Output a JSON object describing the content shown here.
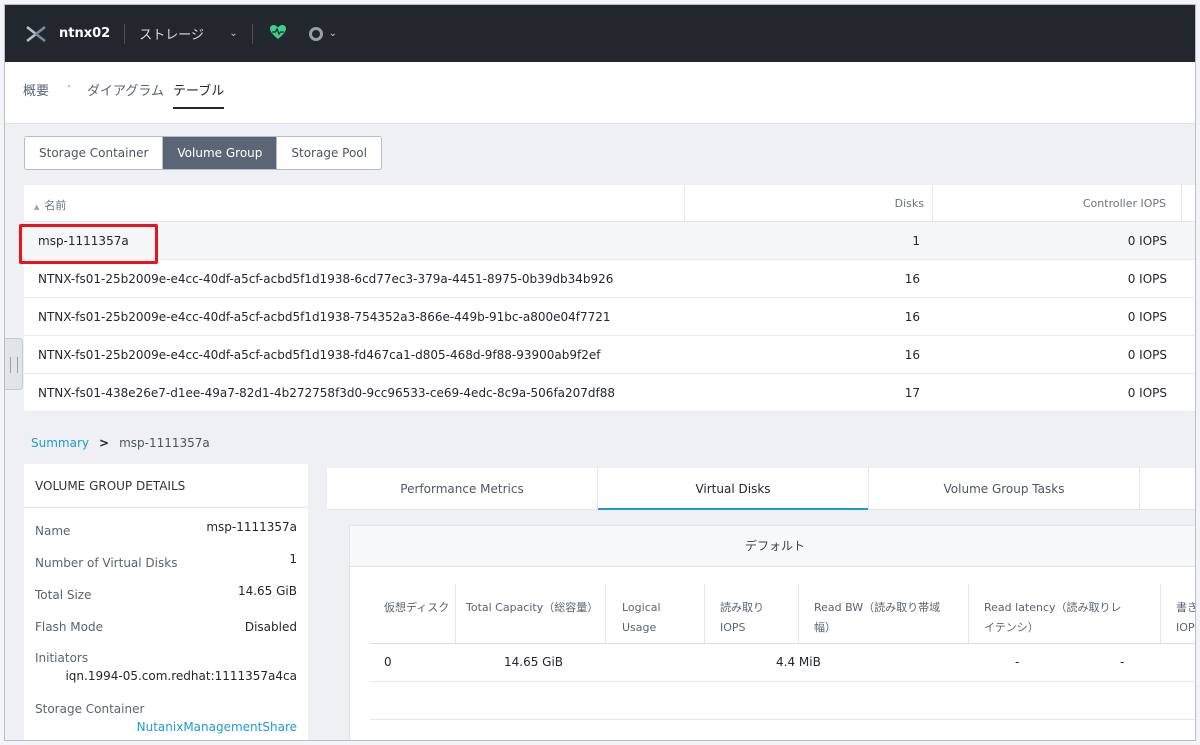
{
  "topbar": {
    "cluster_name": "ntnx02",
    "section": "ストレージ",
    "colors": {
      "bg": "#22272e",
      "health": "#3ecf8e"
    }
  },
  "subnav": {
    "items": [
      "概要",
      "ダイアグラム",
      "テーブル"
    ],
    "separator": "·",
    "active": "テーブル"
  },
  "entity_tabs": [
    "Storage Container",
    "Volume Group",
    "Storage Pool"
  ],
  "entity_tabs_active": "Volume Group",
  "table": {
    "headers": {
      "name": "名前",
      "disks": "Disks",
      "iops": "Controller IOPS"
    },
    "sort_icon": "▲",
    "rows": [
      {
        "name": "msp-1111357a",
        "disks": "1",
        "iops": "0 IOPS"
      },
      {
        "name": "NTNX-fs01-25b2009e-e4cc-40df-a5cf-acbd5f1d1938-6cd77ec3-379a-4451-8975-0b39db34b926",
        "disks": "16",
        "iops": "0 IOPS"
      },
      {
        "name": "NTNX-fs01-25b2009e-e4cc-40df-a5cf-acbd5f1d1938-754352a3-866e-449b-91bc-a800e04f7721",
        "disks": "16",
        "iops": "0 IOPS"
      },
      {
        "name": "NTNX-fs01-25b2009e-e4cc-40df-a5cf-acbd5f1d1938-fd467ca1-d805-468d-9f88-93900ab9f2ef",
        "disks": "16",
        "iops": "0 IOPS"
      },
      {
        "name": "NTNX-fs01-438e26e7-d1ee-49a7-82d1-4b272758f3d0-9cc96533-ce69-4edc-8c9a-506fa207df88",
        "disks": "17",
        "iops": "0 IOPS"
      }
    ]
  },
  "breadcrumb": {
    "root": "Summary",
    "arrow": ">",
    "current": "msp-1111357a"
  },
  "details": {
    "header": "VOLUME GROUP DETAILS",
    "name_label": "Name",
    "name_value": "msp-1111357a",
    "vdisks_label": "Number of Virtual Disks",
    "vdisks_value": "1",
    "size_label": "Total Size",
    "size_value": "14.65 GiB",
    "flash_label": "Flash Mode",
    "flash_value": "Disabled",
    "initiators_label": "Initiators",
    "initiators_value": "iqn.1994-05.com.redhat:1111357a4ca",
    "container_label": "Storage Container",
    "container_value": "NutanixManagementShare"
  },
  "right_tabs": [
    "Performance Metrics",
    "Virtual Disks",
    "Volume Group Tasks"
  ],
  "right_tabs_active": "Virtual Disks",
  "vdisk_panel": {
    "title": "デフォルト",
    "headers": {
      "vdisk": "仮想ディスク",
      "total_capacity": "Total Capacity（総容量）",
      "logical_usage": "Logical Usage",
      "read_iops": "読み取りIOPS",
      "read_bw": "Read BW（読み取り帯域幅）",
      "read_latency": "Read latency（読み取りレイテンシ）",
      "write_iops": "書きIOP"
    },
    "rows": [
      {
        "vdisk": "0",
        "total_capacity": "14.65 GiB",
        "logical_usage": "4.4 MiB",
        "read_latency": "-",
        "extra": "-"
      }
    ]
  }
}
